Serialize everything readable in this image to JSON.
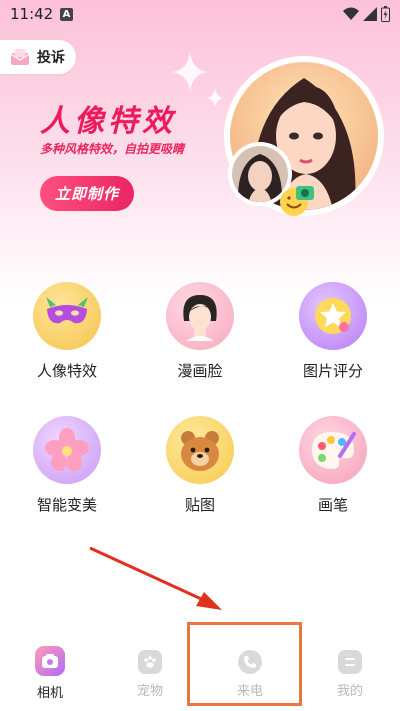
{
  "status_bar": {
    "time": "11:42",
    "notification_letter": "A"
  },
  "top": {
    "complain_label": "投诉"
  },
  "hero": {
    "title": "人像特效",
    "subtitle": "多种风格特效，自拍更吸睛",
    "cta_label": "立即制作"
  },
  "features": [
    {
      "label": "人像特效",
      "icon": "mask-icon"
    },
    {
      "label": "漫画脸",
      "icon": "cartoon-face-icon"
    },
    {
      "label": "图片评分",
      "icon": "star-rating-icon"
    },
    {
      "label": "智能变美",
      "icon": "flower-icon"
    },
    {
      "label": "贴图",
      "icon": "bear-sticker-icon"
    },
    {
      "label": "画笔",
      "icon": "palette-icon"
    }
  ],
  "bottom_nav": [
    {
      "label": "相机",
      "icon": "camera-icon",
      "active": true
    },
    {
      "label": "宠物",
      "icon": "paw-icon",
      "active": false
    },
    {
      "label": "来电",
      "icon": "phone-icon",
      "active": false
    },
    {
      "label": "我的",
      "icon": "profile-icon",
      "active": false
    }
  ],
  "colors": {
    "accent": "#ec1b5c",
    "highlight_box": "#e8763f",
    "arrow": "#e0301e"
  }
}
